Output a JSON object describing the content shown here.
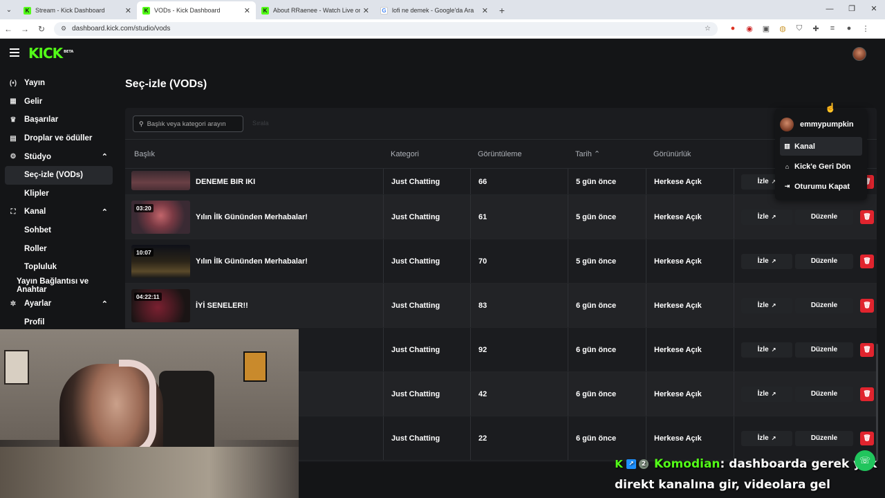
{
  "browser": {
    "tabs": [
      {
        "title": "Stream - Kick Dashboard",
        "active": false,
        "icon": "kick-icon"
      },
      {
        "title": "VODs - Kick Dashboard",
        "active": true,
        "icon": "kick-icon"
      },
      {
        "title": "About RRaenee - Watch Live on",
        "active": false,
        "icon": "kick-icon"
      },
      {
        "title": "lofi ne demek - Google'da Ara",
        "active": false,
        "icon": "google-icon"
      }
    ],
    "url": "dashboard.kick.com/studio/vods"
  },
  "app": {
    "logo": "KICK",
    "logo_badge": "BETA",
    "sidebar": [
      {
        "label": "Yayın",
        "icon": "broadcast-icon",
        "level": 0
      },
      {
        "label": "Gelir",
        "icon": "revenue-icon",
        "level": 0
      },
      {
        "label": "Başarılar",
        "icon": "trophy-icon",
        "level": 0
      },
      {
        "label": "Droplar ve ödüller",
        "icon": "gift-icon",
        "level": 0
      },
      {
        "label": "Stüdyo",
        "icon": "studio-icon",
        "level": 0,
        "chevron": "up"
      },
      {
        "label": "Seç-izle (VODs)",
        "level": 1,
        "active": true
      },
      {
        "label": "Klipler",
        "level": 1
      },
      {
        "label": "Kanal",
        "icon": "channel-icon",
        "level": 0,
        "chevron": "up"
      },
      {
        "label": "Sohbet",
        "level": 1
      },
      {
        "label": "Roller",
        "level": 1
      },
      {
        "label": "Topluluk",
        "level": 1
      },
      {
        "label": "Yayın Bağlantısı ve Anahtar",
        "level": 2
      },
      {
        "label": "Ayarlar",
        "icon": "settings-icon",
        "level": 0,
        "chevron": "up"
      },
      {
        "label": "Profil",
        "level": 1
      }
    ],
    "page_title": "Seç-izle (VODs)",
    "search_placeholder": "Başlık veya kategori arayın",
    "filter_ghost": "Sırala",
    "columns": [
      "Başlık",
      "Kategori",
      "Görüntüleme",
      "Tarih",
      "Görünürlük"
    ],
    "sort_indicator": "^",
    "rows": [
      {
        "title": "DENEME BIR IKI",
        "duration": "",
        "category": "Just Chatting",
        "views": "66",
        "date": "5 gün önce",
        "visibility": "Herkese Açık"
      },
      {
        "title": "Yılın İlk Gününden Merhabalar!",
        "duration": "03:20",
        "category": "Just Chatting",
        "views": "61",
        "date": "5 gün önce",
        "visibility": "Herkese Açık"
      },
      {
        "title": "Yılın İlk Gününden Merhabalar!",
        "duration": "10:07",
        "category": "Just Chatting",
        "views": "70",
        "date": "5 gün önce",
        "visibility": "Herkese Açık"
      },
      {
        "title": "İYİ SENELER!!",
        "duration": "04:22:11",
        "category": "Just Chatting",
        "views": "83",
        "date": "6 gün önce",
        "visibility": "Herkese Açık"
      },
      {
        "title": "",
        "duration": "",
        "category": "Just Chatting",
        "views": "92",
        "date": "6 gün önce",
        "visibility": "Herkese Açık"
      },
      {
        "title": "",
        "duration": "",
        "category": "Just Chatting",
        "views": "42",
        "date": "6 gün önce",
        "visibility": "Herkese Açık"
      },
      {
        "title": "",
        "duration": "",
        "category": "Just Chatting",
        "views": "22",
        "date": "6 gün önce",
        "visibility": "Herkese Açık"
      }
    ],
    "actions": {
      "watch": "İzle",
      "edit": "Düzenle"
    },
    "dropdown": {
      "username": "emmypumpkin",
      "items": [
        {
          "label": "Kanal",
          "icon": "channel-icon"
        },
        {
          "label": "Kick'e Geri Dön",
          "icon": "home-icon"
        },
        {
          "label": "Oturumu Kapat",
          "icon": "logout-icon"
        }
      ]
    }
  },
  "overlay": {
    "chat": {
      "username": "Komodian",
      "message_line1": ": dashboarda gerek yok",
      "message_line2": "direkt kanalına gir, videolara gel",
      "badge_count": "2"
    }
  }
}
